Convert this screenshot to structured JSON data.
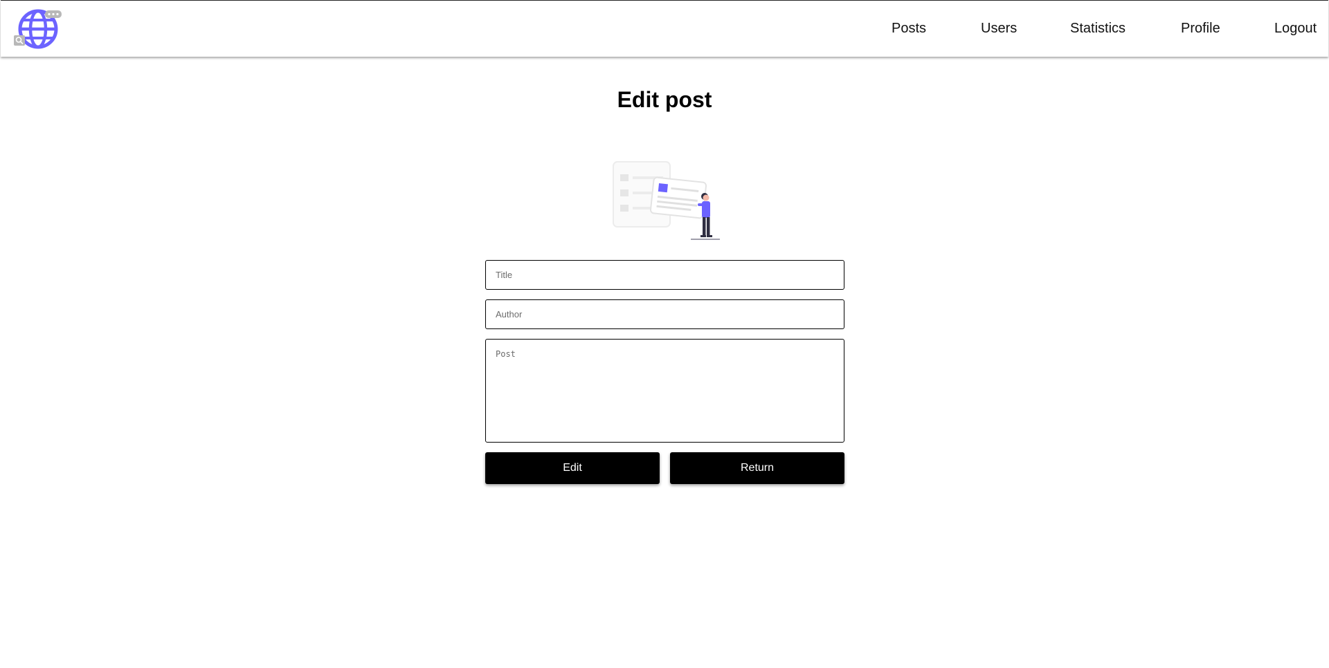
{
  "navbar": {
    "logo_icon": "globe-search-icon",
    "links": [
      {
        "label": "Posts"
      },
      {
        "label": "Users"
      },
      {
        "label": "Statistics"
      },
      {
        "label": "Profile"
      },
      {
        "label": "Logout"
      }
    ]
  },
  "main": {
    "title": "Edit post",
    "illustration_icon": "editing-post-illustration",
    "form": {
      "title_placeholder": "Title",
      "title_value": "",
      "author_placeholder": "Author",
      "author_value": "",
      "post_placeholder": "Post",
      "post_value": "",
      "edit_label": "Edit",
      "return_label": "Return"
    }
  },
  "colors": {
    "accent": "#6c63ff",
    "button_bg": "#000000",
    "button_text": "#ffffff"
  }
}
